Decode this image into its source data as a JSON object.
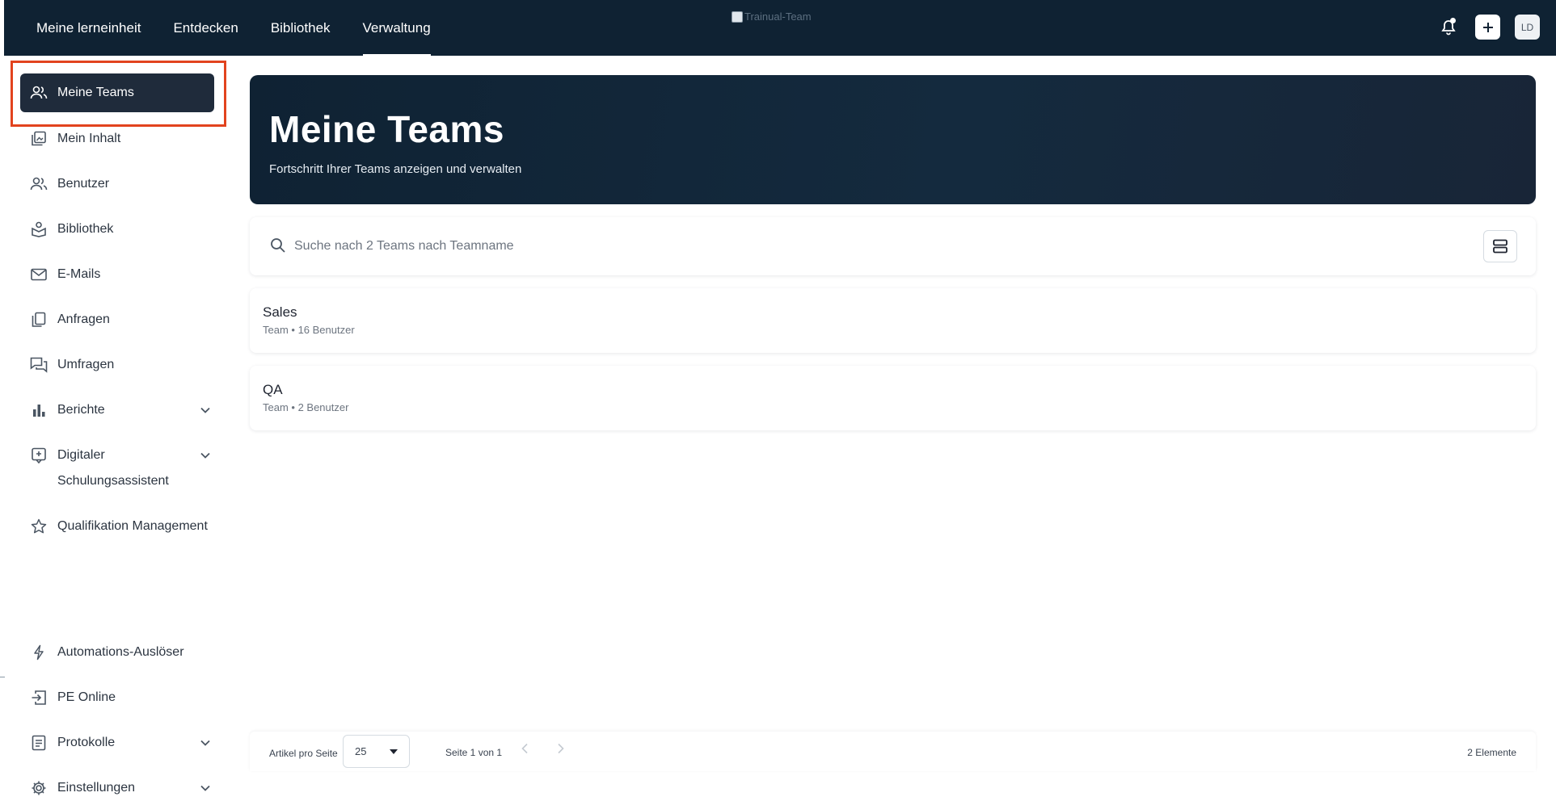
{
  "topnav": {
    "items": [
      {
        "label": "Meine lerneinheit",
        "active": false
      },
      {
        "label": "Entdecken",
        "active": false
      },
      {
        "label": "Bibliothek",
        "active": false
      },
      {
        "label": "Verwaltung",
        "active": true
      }
    ],
    "logo_alt": "Trainual-Team",
    "avatar_initials": "LD"
  },
  "sidebar": {
    "items": [
      {
        "label": "Meine Teams",
        "icon": "users-icon",
        "active": true
      },
      {
        "label": "Mein Inhalt",
        "icon": "content-icon"
      },
      {
        "label": "Benutzer",
        "icon": "user-icon"
      },
      {
        "label": "Bibliothek",
        "icon": "library-icon"
      },
      {
        "label": "E-Mails",
        "icon": "mail-icon"
      },
      {
        "label": "Anfragen",
        "icon": "copy-icon"
      },
      {
        "label": "Umfragen",
        "icon": "chat-icon"
      },
      {
        "label": "Berichte",
        "icon": "bar-chart-icon",
        "expandable": true
      },
      {
        "label": "Digitaler Schulungsassistent",
        "icon": "assistant-icon",
        "expandable": true
      },
      {
        "label": "Qualifikation Management",
        "icon": "star-icon"
      },
      {
        "label": "Automations-Auslöser",
        "icon": "bolt-icon"
      },
      {
        "label": "PE Online",
        "icon": "login-icon"
      },
      {
        "label": "Protokolle",
        "icon": "log-icon",
        "expandable": true
      },
      {
        "label": "Einstellungen",
        "icon": "gear-icon",
        "expandable": true
      }
    ]
  },
  "hero": {
    "title": "Meine Teams",
    "subtitle": "Fortschritt Ihrer Teams anzeigen und verwalten"
  },
  "search": {
    "placeholder": "Suche nach 2 Teams nach Teamname",
    "value": ""
  },
  "teams": [
    {
      "name": "Sales",
      "meta": "Team • 16 Benutzer"
    },
    {
      "name": "QA",
      "meta": "Team • 2 Benutzer"
    }
  ],
  "footer": {
    "per_page_label": "Artikel pro Seite",
    "per_page_value": "25",
    "page_info": "Seite 1 von 1",
    "total": "2 Elemente"
  },
  "colors": {
    "topbar_bg": "#0f2233",
    "active_sidebar_bg": "#1f2b3b",
    "highlight_border": "#e2431e"
  }
}
